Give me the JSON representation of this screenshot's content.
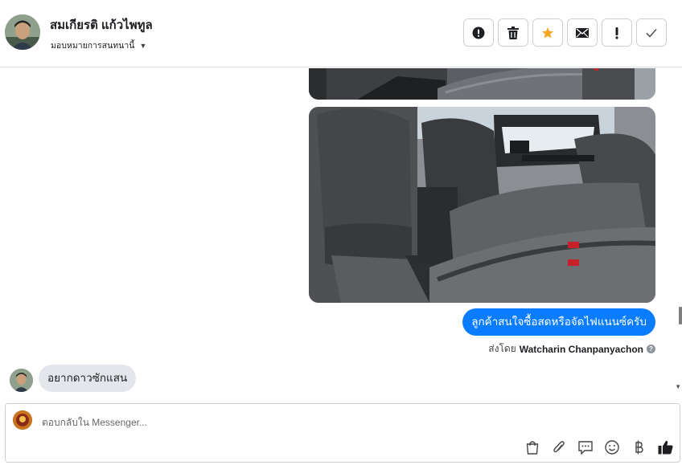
{
  "header": {
    "contact_name": "สมเกียรติ แก้วไพทูล",
    "assign_label": "มอบหมายการสนทนานี้"
  },
  "actions": [
    {
      "name": "report-spam",
      "icon": "exclamation-circle-icon"
    },
    {
      "name": "delete",
      "icon": "trash-icon"
    },
    {
      "name": "star",
      "icon": "star-icon"
    },
    {
      "name": "mark-unread",
      "icon": "envelope-icon"
    },
    {
      "name": "follow-up",
      "icon": "exclamation-icon"
    },
    {
      "name": "mark-done",
      "icon": "checkmark-icon"
    }
  ],
  "thread": {
    "outgoing_message": "ลูกค้าสนใจซื้อสดหรือจัดไฟแนนซ์ครับ",
    "sent_by_prefix": "ส่งโดย",
    "sent_by_name": "Watcharin Chanpanyachon",
    "incoming_message": "อยากดาวซักแสน"
  },
  "composer": {
    "placeholder": "ตอบกลับใน Messenger..."
  },
  "colors": {
    "accent": "#0a7cff",
    "star": "#f5a623",
    "incoming_bubble": "#e4e6eb"
  }
}
